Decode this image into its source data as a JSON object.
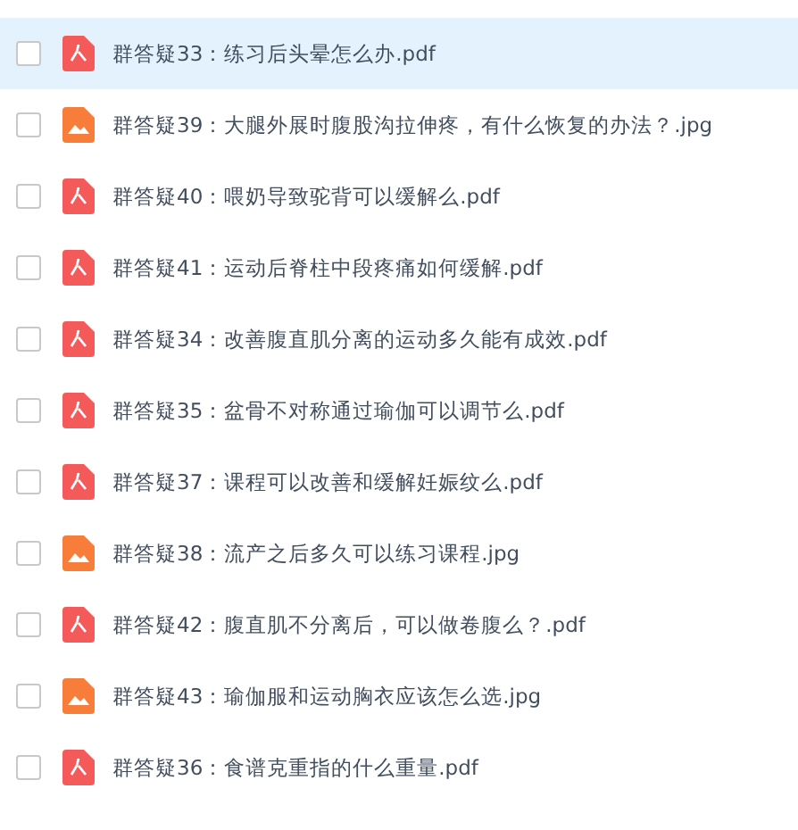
{
  "files": [
    {
      "name": "群答疑33：练习后头晕怎么办.pdf",
      "kind": "pdf",
      "selected": true,
      "checked": false
    },
    {
      "name": "群答疑39：大腿外展时腹股沟拉伸疼，有什么恢复的办法？.jpg",
      "kind": "image",
      "selected": false,
      "checked": false
    },
    {
      "name": "群答疑40：喂奶导致驼背可以缓解么.pdf",
      "kind": "pdf",
      "selected": false,
      "checked": false
    },
    {
      "name": "群答疑41：运动后脊柱中段疼痛如何缓解.pdf",
      "kind": "pdf",
      "selected": false,
      "checked": false
    },
    {
      "name": "群答疑34：改善腹直肌分离的运动多久能有成效.pdf",
      "kind": "pdf",
      "selected": false,
      "checked": false
    },
    {
      "name": "群答疑35：盆骨不对称通过瑜伽可以调节么.pdf",
      "kind": "pdf",
      "selected": false,
      "checked": false
    },
    {
      "name": "群答疑37：课程可以改善和缓解妊娠纹么.pdf",
      "kind": "pdf",
      "selected": false,
      "checked": false
    },
    {
      "name": "群答疑38：流产之后多久可以练习课程.jpg",
      "kind": "image",
      "selected": false,
      "checked": false
    },
    {
      "name": "群答疑42：腹直肌不分离后，可以做卷腹么？.pdf",
      "kind": "pdf",
      "selected": false,
      "checked": false
    },
    {
      "name": "群答疑43：瑜伽服和运动胸衣应该怎么选.jpg",
      "kind": "image",
      "selected": false,
      "checked": false
    },
    {
      "name": "群答疑36：食谱克重指的什么重量.pdf",
      "kind": "pdf",
      "selected": false,
      "checked": false
    }
  ]
}
